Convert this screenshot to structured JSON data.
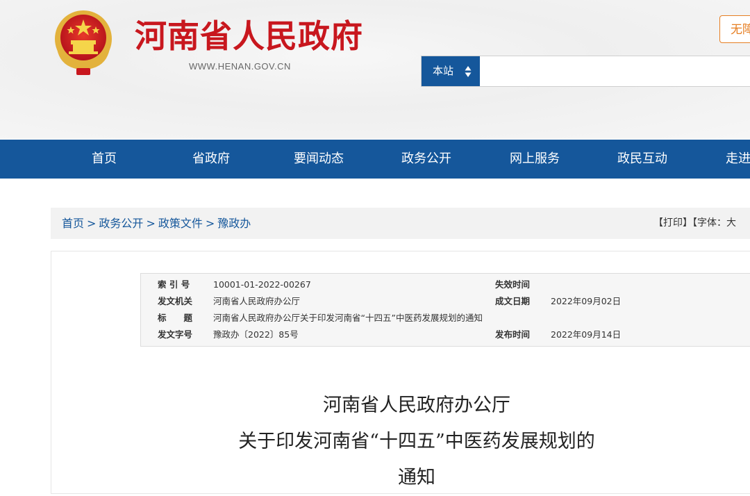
{
  "header": {
    "site_title": "河南省人民政府",
    "site_url": "WWW.HENAN.GOV.CN",
    "accessibility_label": "无障碍",
    "search": {
      "scope_label": "本站",
      "placeholder": ""
    }
  },
  "nav": {
    "items": [
      "首页",
      "省政府",
      "要闻动态",
      "政务公开",
      "网上服务",
      "政民互动",
      "走进河南"
    ]
  },
  "breadcrumb": {
    "items": [
      "首页",
      "政务公开",
      "政策文件",
      "豫政办"
    ],
    "separator": ">"
  },
  "tools": {
    "print_label": "【打印】",
    "font_label": "【字体：",
    "font_large": "大"
  },
  "meta": {
    "index_label": "索 引 号",
    "index_value": "10001-01-2022-00267",
    "expire_label": "失效时间",
    "expire_value": "",
    "issuer_label": "发文机关",
    "issuer_value": "河南省人民政府办公厅",
    "created_label": "成文日期",
    "created_value": "2022年09月02日",
    "subject_label": "标　　题",
    "subject_value": "河南省人民政府办公厅关于印发河南省“十四五”中医药发展规划的通知",
    "docno_label": "发文字号",
    "docno_value": "豫政办〔2022〕85号",
    "published_label": "发布时间",
    "published_value": "2022年09月14日"
  },
  "document": {
    "title_line1": "河南省人民政府办公厅",
    "title_line2": "关于印发河南省“十四五”中医药发展规划的",
    "title_line3": "通知"
  },
  "colors": {
    "brand_red": "#c8171e",
    "nav_blue": "#15579b",
    "accent_orange": "#e67e22"
  }
}
